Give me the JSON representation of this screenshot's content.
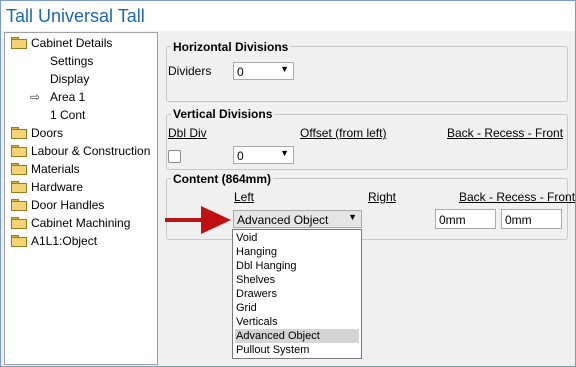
{
  "window": {
    "title": "Tall Universal Tall"
  },
  "tree": {
    "items": [
      {
        "label": "Cabinet Details",
        "kind": "folder"
      },
      {
        "label": "Settings",
        "kind": "child"
      },
      {
        "label": "Display",
        "kind": "child"
      },
      {
        "label": "Area 1",
        "kind": "child-selected"
      },
      {
        "label": "1 Cont",
        "kind": "child"
      },
      {
        "label": "Doors",
        "kind": "folder"
      },
      {
        "label": "Labour & Construction",
        "kind": "folder"
      },
      {
        "label": "Materials",
        "kind": "folder"
      },
      {
        "label": "Hardware",
        "kind": "folder"
      },
      {
        "label": "Door Handles",
        "kind": "folder"
      },
      {
        "label": "Cabinet Machining",
        "kind": "folder"
      },
      {
        "label": "A1L1:Object",
        "kind": "folder"
      }
    ]
  },
  "horizontal": {
    "title": "Horizontal Divisions",
    "dividers_label": "Dividers",
    "dividers_value": "0"
  },
  "vertical": {
    "title": "Vertical Divisions",
    "dbl_div_label": "Dbl Div",
    "offset_label": "Offset (from left)",
    "brf_label": "Back - Recess - Front",
    "offset_value": "0",
    "dbl_div_checked": false
  },
  "content": {
    "title": "Content (864mm)",
    "left_label": "Left",
    "right_label": "Right",
    "brf_label": "Back - Recess - Front",
    "left_value": "Advanced Object",
    "back_value": "0mm",
    "front_value": "0mm",
    "options": [
      "Void",
      "Hanging",
      "Dbl Hanging",
      "Shelves",
      "Drawers",
      "Grid",
      "Verticals",
      "Advanced Object",
      "Pullout System"
    ],
    "selected_option": "Advanced Object"
  },
  "colors": {
    "title": "#1b66b0",
    "arrow": "#c01010",
    "folder": "#f2d477"
  }
}
